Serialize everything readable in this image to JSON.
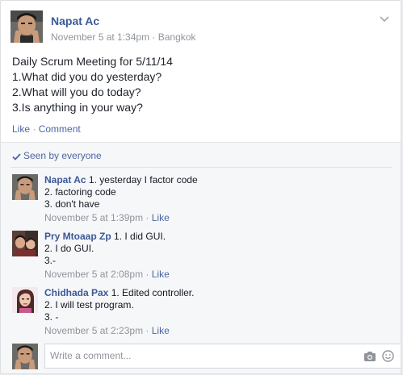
{
  "post": {
    "author": "Napat Ac",
    "timestamp": "November 5 at 1:34pm",
    "separator": " · ",
    "location": "Bangkok",
    "body_lines": [
      "Daily Scrum Meeting for 5/11/14",
      "1.What did you do yesterday?",
      "2.What will you do today?",
      "3.Is anything in your way?"
    ],
    "actions": {
      "like": "Like",
      "sep": " · ",
      "comment": "Comment"
    }
  },
  "seen": {
    "text": "Seen by everyone",
    "icon": "checkmark-icon"
  },
  "comments": [
    {
      "author": "Napat Ac",
      "lines": [
        "1. yesterday I factor code",
        "2. factoring code",
        "3. don't have"
      ],
      "timestamp": "November 5 at 1:39pm",
      "like": "Like"
    },
    {
      "author": "Pry Mtoaap Zp",
      "lines": [
        "1. I did GUI.",
        "2. I do GUI.",
        "3.-"
      ],
      "timestamp": "November 5 at 2:08pm",
      "like": "Like"
    },
    {
      "author": "Chidhada Pax",
      "lines": [
        "1. Edited controller.",
        "2. I will test program.",
        "3. -"
      ],
      "timestamp": "November 5 at 2:23pm",
      "like": "Like"
    }
  ],
  "composer": {
    "placeholder": "Write a comment...",
    "icons": [
      "camera-icon",
      "emoji-icon"
    ]
  },
  "colors": {
    "link": "#3b5998",
    "secondary": "#90949c",
    "feedback_bg": "#f6f7f9"
  }
}
